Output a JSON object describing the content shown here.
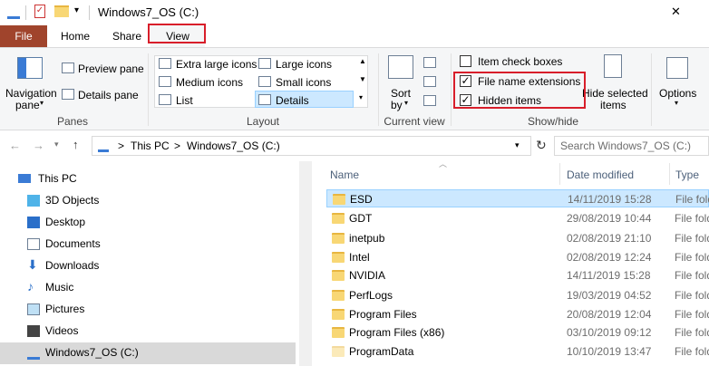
{
  "window": {
    "title": "Windows7_OS (C:)",
    "close_glyph": "✕"
  },
  "tabs": [
    {
      "label": "File"
    },
    {
      "label": "Home"
    },
    {
      "label": "Share"
    },
    {
      "label": "View"
    }
  ],
  "ribbon": {
    "panes": {
      "navigation_pane": "Navigation",
      "navigation_pane2": "pane",
      "preview_pane": "Preview pane",
      "details_pane": "Details pane",
      "group_label": "Panes"
    },
    "layout": {
      "extra_large_icons": "Extra large icons",
      "large_icons": "Large icons",
      "medium_icons": "Medium icons",
      "small_icons": "Small icons",
      "list": "List",
      "details": "Details",
      "group_label": "Layout"
    },
    "current_view": {
      "sort_by": "Sort",
      "sort_by2": "by",
      "group_label": "Current view"
    },
    "show_hide": {
      "item_check_boxes": "Item check boxes",
      "file_name_extensions": "File name extensions",
      "hidden_items": "Hidden items",
      "hide_selected": "Hide selected",
      "hide_selected2": "items",
      "group_label": "Show/hide",
      "item_check_boxes_checked": false,
      "file_name_extensions_checked": true,
      "hidden_items_checked": true
    },
    "options": {
      "label": "Options"
    }
  },
  "address": {
    "crumbs": [
      "This PC",
      "Windows7_OS (C:)"
    ],
    "separator": ">",
    "search_placeholder": "Search Windows7_OS (C:)"
  },
  "nav": {
    "items": [
      {
        "label": "This PC",
        "icon": "pc-icon"
      },
      {
        "label": "3D Objects",
        "icon": "cube-icon"
      },
      {
        "label": "Desktop",
        "icon": "desktop-icon"
      },
      {
        "label": "Documents",
        "icon": "documents-icon"
      },
      {
        "label": "Downloads",
        "icon": "download-icon"
      },
      {
        "label": "Music",
        "icon": "music-icon"
      },
      {
        "label": "Pictures",
        "icon": "pictures-icon"
      },
      {
        "label": "Videos",
        "icon": "videos-icon"
      },
      {
        "label": "Windows7_OS (C:)",
        "icon": "drive-icon"
      }
    ]
  },
  "list": {
    "columns": {
      "name": "Name",
      "date": "Date modified",
      "type": "Type"
    },
    "rows": [
      {
        "name": "ESD",
        "date": "14/11/2019 15:28",
        "type": "File folder"
      },
      {
        "name": "GDT",
        "date": "29/08/2019 10:44",
        "type": "File folder"
      },
      {
        "name": "inetpub",
        "date": "02/08/2019 21:10",
        "type": "File folder"
      },
      {
        "name": "Intel",
        "date": "02/08/2019 12:24",
        "type": "File folder"
      },
      {
        "name": "NVIDIA",
        "date": "14/11/2019 15:28",
        "type": "File folder"
      },
      {
        "name": "PerfLogs",
        "date": "19/03/2019 04:52",
        "type": "File folder"
      },
      {
        "name": "Program Files",
        "date": "20/08/2019 12:04",
        "type": "File folder"
      },
      {
        "name": "Program Files (x86)",
        "date": "03/10/2019 09:12",
        "type": "File folder"
      },
      {
        "name": "ProgramData",
        "date": "10/10/2019 13:47",
        "type": "File folder"
      }
    ]
  },
  "colors": {
    "accent": "#1979ca",
    "file_tab": "#a0442c",
    "highlight": "#cce8ff",
    "red": "#d81e2a"
  }
}
